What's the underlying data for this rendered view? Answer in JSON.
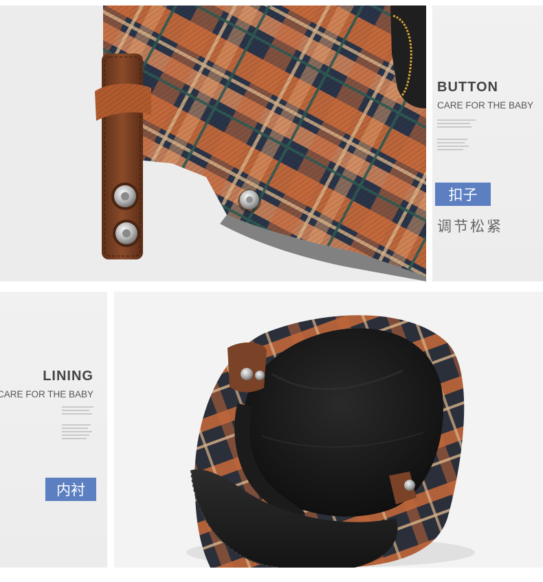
{
  "button_section": {
    "heading": "BUTTON",
    "subheading": "CARE FOR THE BABY",
    "badge": "扣子",
    "caption": "调节松紧"
  },
  "lining_section": {
    "heading": "LINING",
    "subheading": "CARE FOR THE BABY",
    "badge": "内衬"
  },
  "colors": {
    "badge_blue": "#5b7fc0",
    "plaid_orange": "#c8693a",
    "plaid_navy": "#27324a",
    "leather_brown": "#7a4226"
  }
}
